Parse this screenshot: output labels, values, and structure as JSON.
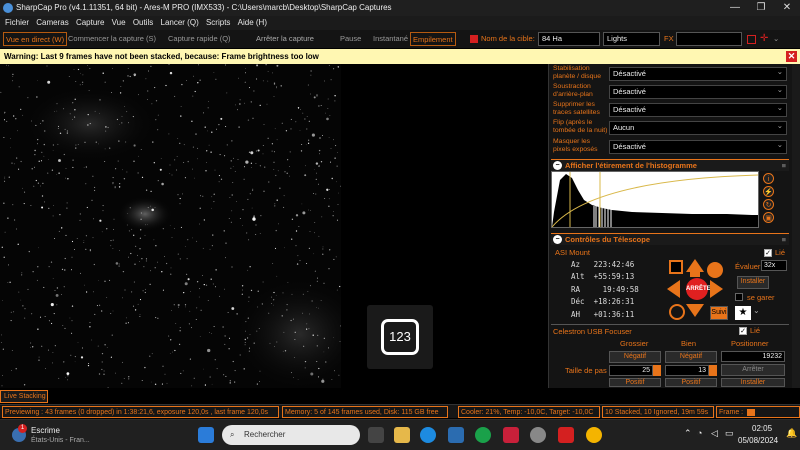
{
  "titlebar": {
    "title": "SharpCap Pro (v4.1.11351, 64 bit) - Ares-M PRO (IMX533) - C:\\Users\\marcb\\Desktop\\SharpCap Captures",
    "minimize": "—",
    "maximize": "❐",
    "close": "✕"
  },
  "menu": [
    "Fichier",
    "Cameras",
    "Capture",
    "Vue",
    "Outils",
    "Lancer (Q)",
    "Scripts",
    "Aide (H)"
  ],
  "toolbar": {
    "live": "Vue en direct (W)",
    "start_capture": "Commencer la capture (S)",
    "quick_capture": "Capture rapide (Q)",
    "stop_capture": "Arrêter la capture",
    "pause": "Pause",
    "snapshot": "Instantané",
    "stacking": "Empilement",
    "target_label": "Nom de la cible:",
    "target_value": "84 Ha",
    "frame_type": "Lights",
    "fx_label": "FX"
  },
  "warning": {
    "text": "Warning: Last 9 frames have not been stacked, because: Frame brightness too low",
    "close": "✕"
  },
  "counter_badge": "123",
  "settings": [
    {
      "label": "Stabilisation planète / disque",
      "value": "Désactivé"
    },
    {
      "label": "Soustraction d'arrière-plan",
      "value": "Désactivé"
    },
    {
      "label": "Supprimer les traces satellites",
      "value": "Désactivé"
    },
    {
      "label": "Flip (après le tombée de la nuit)",
      "value": "Aucun"
    },
    {
      "label": "Masquer les pixels exposés",
      "value": "Désactivé"
    }
  ],
  "histogram": {
    "title": "Afficher l'étirement de l'histogramme",
    "toggle": "−",
    "menu": "≡"
  },
  "telescope": {
    "title": "Contrôles du Télescope",
    "toggle": "−",
    "menu": "≡",
    "mount_name": "ASI Mount",
    "linked_label": "Lié",
    "az": "Az   223:42:46",
    "alt": "Alt  +55:59:13",
    "ra": "RA     19:49:58",
    "dec": "Déc  +18:26:31",
    "ah": "AH   +01:36:11",
    "stop": "ARRÊTE",
    "eval_label": "Évaluer:",
    "eval_value": "32x",
    "install": "Installer",
    "park": "se garer",
    "track": "Suivi"
  },
  "focuser": {
    "name": "Celestron USB Focuser",
    "linked_label": "Lié",
    "col_coarse": "Grossier",
    "col_fine": "Bien",
    "col_position": "Positionner",
    "neg": "Négatif",
    "neg2": "Négatif",
    "position": "19232",
    "step_label": "Taille de pas",
    "coarse_step": "25",
    "fine_step": "13",
    "stop": "Arrêter",
    "pos": "Positif",
    "pos2": "Positif",
    "install": "Installer"
  },
  "live_stacking_tab": "Live Stacking",
  "status": {
    "preview": "Previewing : 43 frames (0 dropped) in 1:38:21,6, exposure 120,0s , last frame 120,0s",
    "memory": "Memory: 5 of 145 frames used, Disk: 115 GB free",
    "cooler": "Cooler: 21%, Temp: -10,0C, Target: -10,0C",
    "stacked": "10 Stacked, 10 Ignored, 19m 59s",
    "frame": "Frame :"
  },
  "taskbar": {
    "weather_title": "Escrime",
    "weather_sub": "États-Unis - Fran...",
    "notification_count": "1",
    "search": "Rechercher",
    "time": "02:05",
    "date": "05/08/2024"
  },
  "colors": {
    "accent": "#e8741a",
    "warning_bg": "#fff7b2",
    "stop_red": "#e02020"
  }
}
